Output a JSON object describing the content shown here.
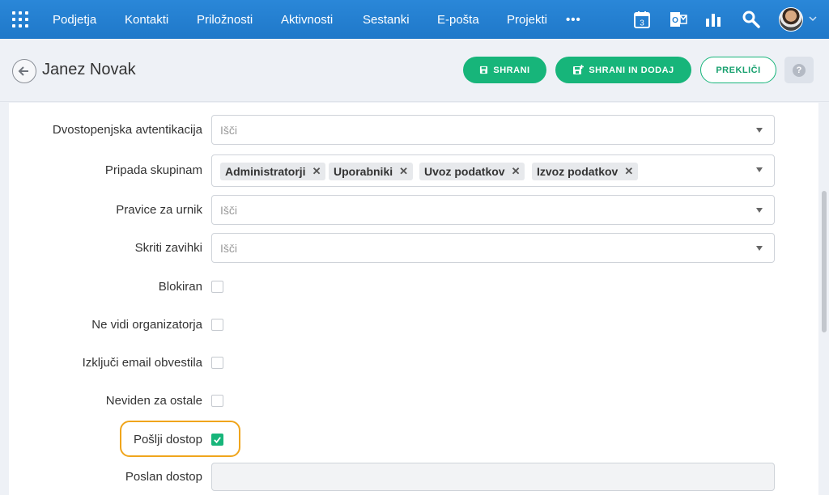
{
  "nav": {
    "items": [
      "Podjetja",
      "Kontakti",
      "Priložnosti",
      "Aktivnosti",
      "Sestanki",
      "E-pošta",
      "Projekti"
    ],
    "more": "•••",
    "calendar_day": "3",
    "icons": [
      "apps-grid-icon",
      "calendar-icon",
      "outlook-icon",
      "reports-icon",
      "search-icon"
    ]
  },
  "header": {
    "title": "Janez Novak",
    "save_label": "SHRANI",
    "save_add_label": "SHRANI IN DODAJ",
    "cancel_label": "PREKLIČI",
    "help_label": "?"
  },
  "form": {
    "two_factor": {
      "label": "Dvostopenjska avtentikacija",
      "placeholder": "Išči"
    },
    "groups": {
      "label": "Pripada skupinam",
      "tags": [
        "Administratorji",
        "Uporabniki",
        "Uvoz podatkov",
        "Izvoz podatkov"
      ]
    },
    "schedule_rights": {
      "label": "Pravice za urnik",
      "placeholder": "Išči"
    },
    "hidden_tabs": {
      "label": "Skriti zavihki",
      "placeholder": "Išči"
    },
    "blocked": {
      "label": "Blokiran",
      "checked": false
    },
    "hide_organizer": {
      "label": "Ne vidi organizatorja",
      "checked": false
    },
    "disable_email": {
      "label": "Izključi email obvestila",
      "checked": false
    },
    "invisible": {
      "label": "Neviden za ostale",
      "checked": false
    },
    "send_access": {
      "label": "Pošlji dostop",
      "checked": true
    },
    "access_sent": {
      "label": "Poslan dostop",
      "value": ""
    }
  },
  "colors": {
    "nav_blue": "#2380d2",
    "accent_green": "#17b57a",
    "highlight_orange": "#f0a51c"
  }
}
